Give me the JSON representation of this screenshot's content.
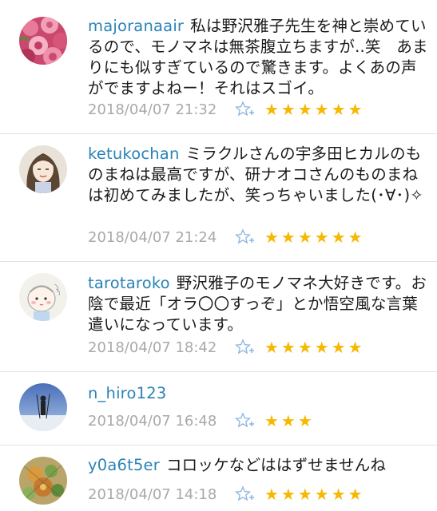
{
  "comments": [
    {
      "username": "majoranaair",
      "text": "私は野沢雅子先生を神と崇めているので、モノマネは無茶腹立ちますが..笑　あまりにも似すぎているので驚きます。よくあの声がでますよねー！それはスゴイ。",
      "timestamp": "2018/04/07 21:32",
      "stars": "★★★★★★",
      "avatar_icon": "roses-photo-avatar"
    },
    {
      "username": "ketukochan",
      "text": "ミラクルさんの宇多田ヒカルのものまねは最高ですが、研ナオコさんのものまねは初めてみましたが、笑っちゃいました(･∀･)✧",
      "timestamp": "2018/04/07 21:24",
      "stars": "★★★★★★",
      "avatar_icon": "girl-drawing-avatar"
    },
    {
      "username": "tarotaroko",
      "text": "野沢雅子のモノマネ大好きです。お陰で最近「オラ〇〇すっぞ」とか悟空風な言葉遣いになっています。",
      "timestamp": "2018/04/07 18:42",
      "stars": "★★★★★★",
      "avatar_icon": "baby-drawing-avatar"
    },
    {
      "username": "n_hiro123",
      "text": "",
      "timestamp": "2018/04/07 16:48",
      "stars": "★★★",
      "avatar_icon": "skier-photo-avatar"
    },
    {
      "username": "y0a6t5er",
      "text": "コロッケなどははずせませんね",
      "timestamp": "2018/04/07 14:18",
      "stars": "★★★★★★",
      "avatar_icon": "flower-art-avatar"
    }
  ],
  "colors": {
    "username": "#2a83b7",
    "star": "#f6b800",
    "timestamp": "#a9a9a9",
    "fav_icon": "#8ab4e0"
  }
}
